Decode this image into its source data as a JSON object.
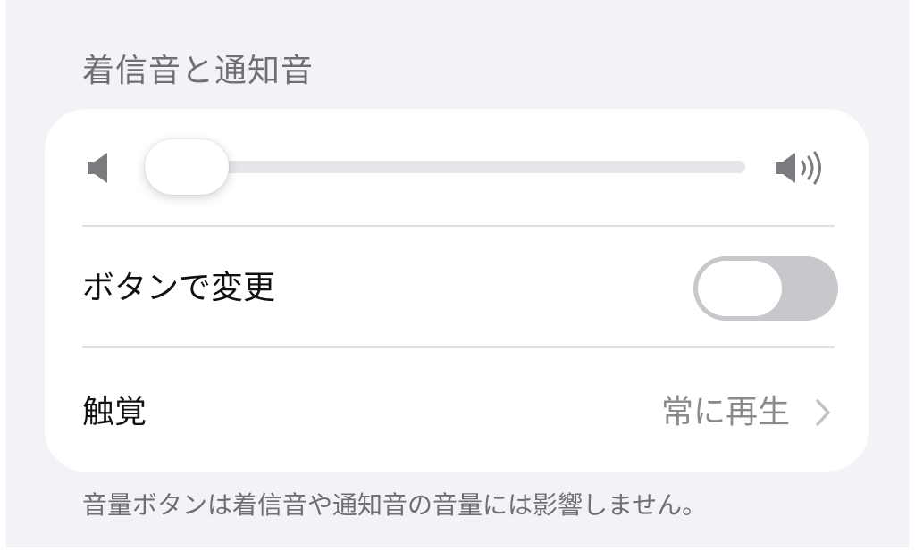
{
  "section": {
    "title": "着信音と通知音"
  },
  "volume": {
    "level_percent": 7,
    "low_icon": "speaker-low-icon",
    "high_icon": "speaker-high-icon",
    "accent_color": "#3a7ae8"
  },
  "change_with_buttons": {
    "label": "ボタンで変更",
    "enabled": false
  },
  "haptics": {
    "label": "触覚",
    "value": "常に再生",
    "icon": "chevron-right-icon"
  },
  "footer": {
    "note": "音量ボタンは着信音や通知音の音量には影響しません。"
  }
}
